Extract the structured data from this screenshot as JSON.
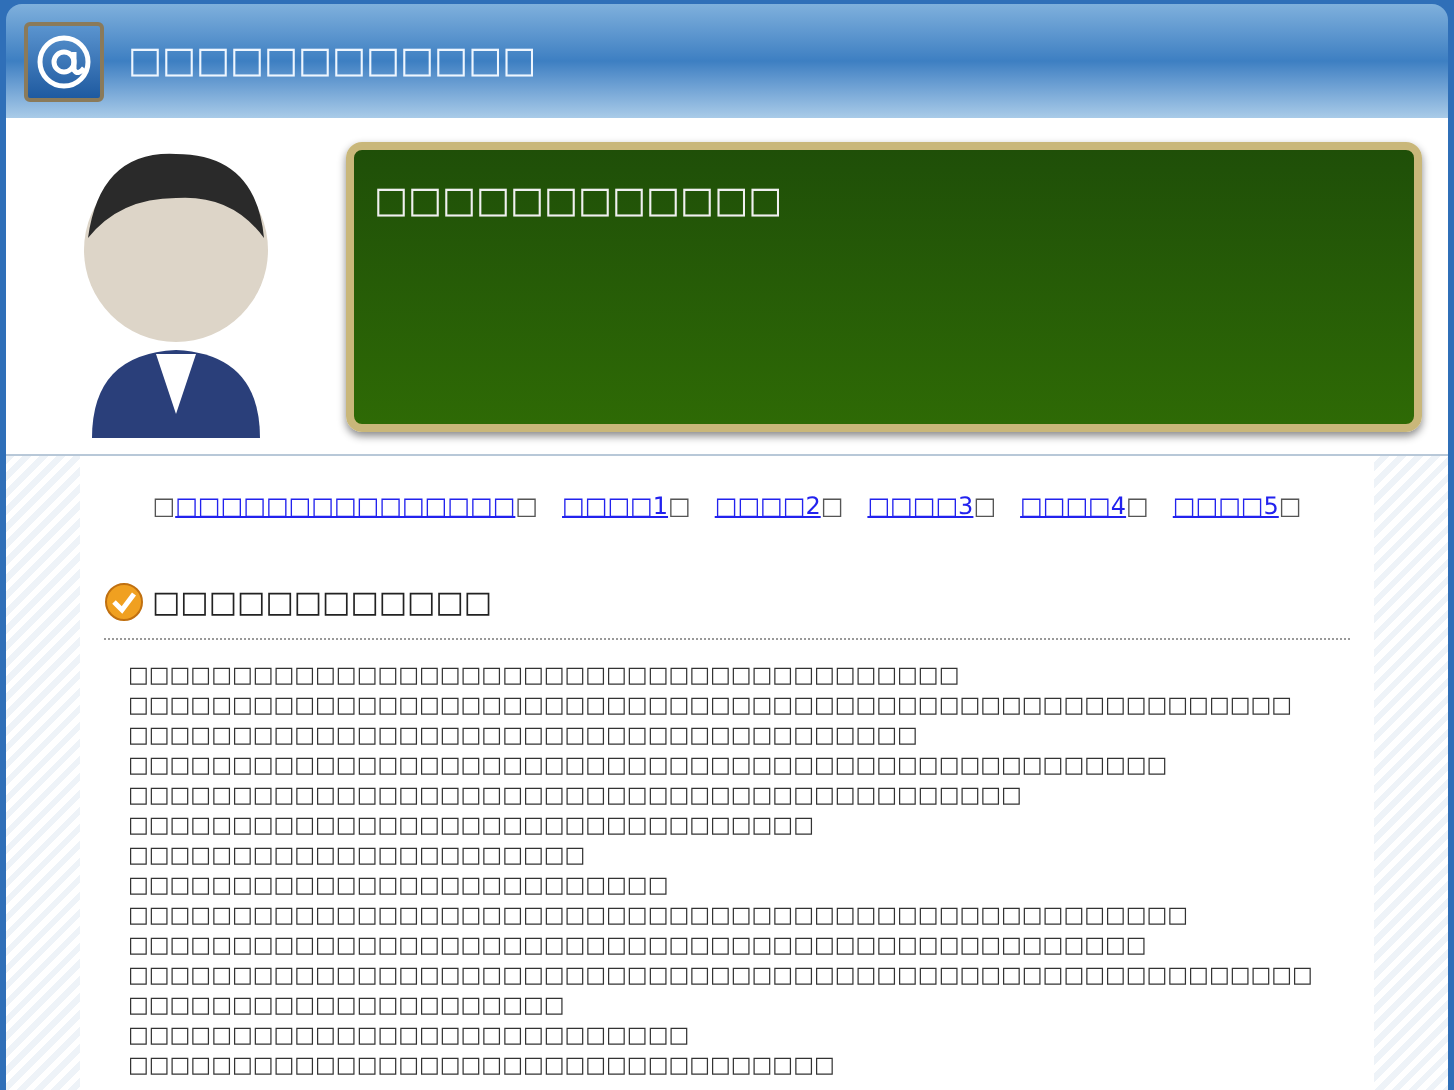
{
  "header": {
    "title": "□□□□□□□□□□□□"
  },
  "hero": {
    "board_text": "□□□□□□□□□□□□"
  },
  "nav": {
    "open": "□",
    "links": [
      {
        "label": "□□□□□□□□□□□□□□□",
        "suffix": "□"
      },
      {
        "label": "□□□□1",
        "suffix": "□"
      },
      {
        "label": "□□□□2",
        "suffix": "□"
      },
      {
        "label": "□□□□3",
        "suffix": "□"
      },
      {
        "label": "□□□□4",
        "suffix": "□"
      },
      {
        "label": "□□□□5",
        "suffix": "□"
      }
    ]
  },
  "section": {
    "heading": "□□□□□□□□□□□□",
    "lines": [
      "□□□□□□□□□□□□□□□□□□□□□□□□□□□□□□□□□□□□□□□□",
      "□□□□□□□□□□□□□□□□□□□□□□□□□□□□□□□□□□□□□□□□□□□□□□□□□□□□□□□□",
      "□□□□□□□□□□□□□□□□□□□□□□□□□□□□□□□□□□□□□□",
      "□□□□□□□□□□□□□□□□□□□□□□□□□□□□□□□□□□□□□□□□□□□□□□□□□□",
      "□□□□□□□□□□□□□□□□□□□□□□□□□□□□□□□□□□□□□□□□□□□",
      "□□□□□□□□□□□□□□□□□□□□□□□□□□□□□□□□□",
      "□□□□□□□□□□□□□□□□□□□□□□",
      "□□□□□□□□□□□□□□□□□□□□□□□□□□",
      "□□□□□□□□□□□□□□□□□□□□□□□□□□□□□□□□□□□□□□□□□□□□□□□□□□□",
      "□□□□□□□□□□□□□□□□□□□□□□□□□□□□□□□□□□□□□□□□□□□□□□□□□",
      "□□□□□□□□□□□□□□□□□□□□□□□□□□□□□□□□□□□□□□□□□□□□□□□□□□□□□□□□□□□□□□□□□□□□□□□□□□□□□□",
      "□□□□□□□□□□□□□□□□□□□□□□□□□□□",
      "□□□□□□□□□□□□□□□□□□□□□□□□□□□□□□□□□□"
    ]
  }
}
